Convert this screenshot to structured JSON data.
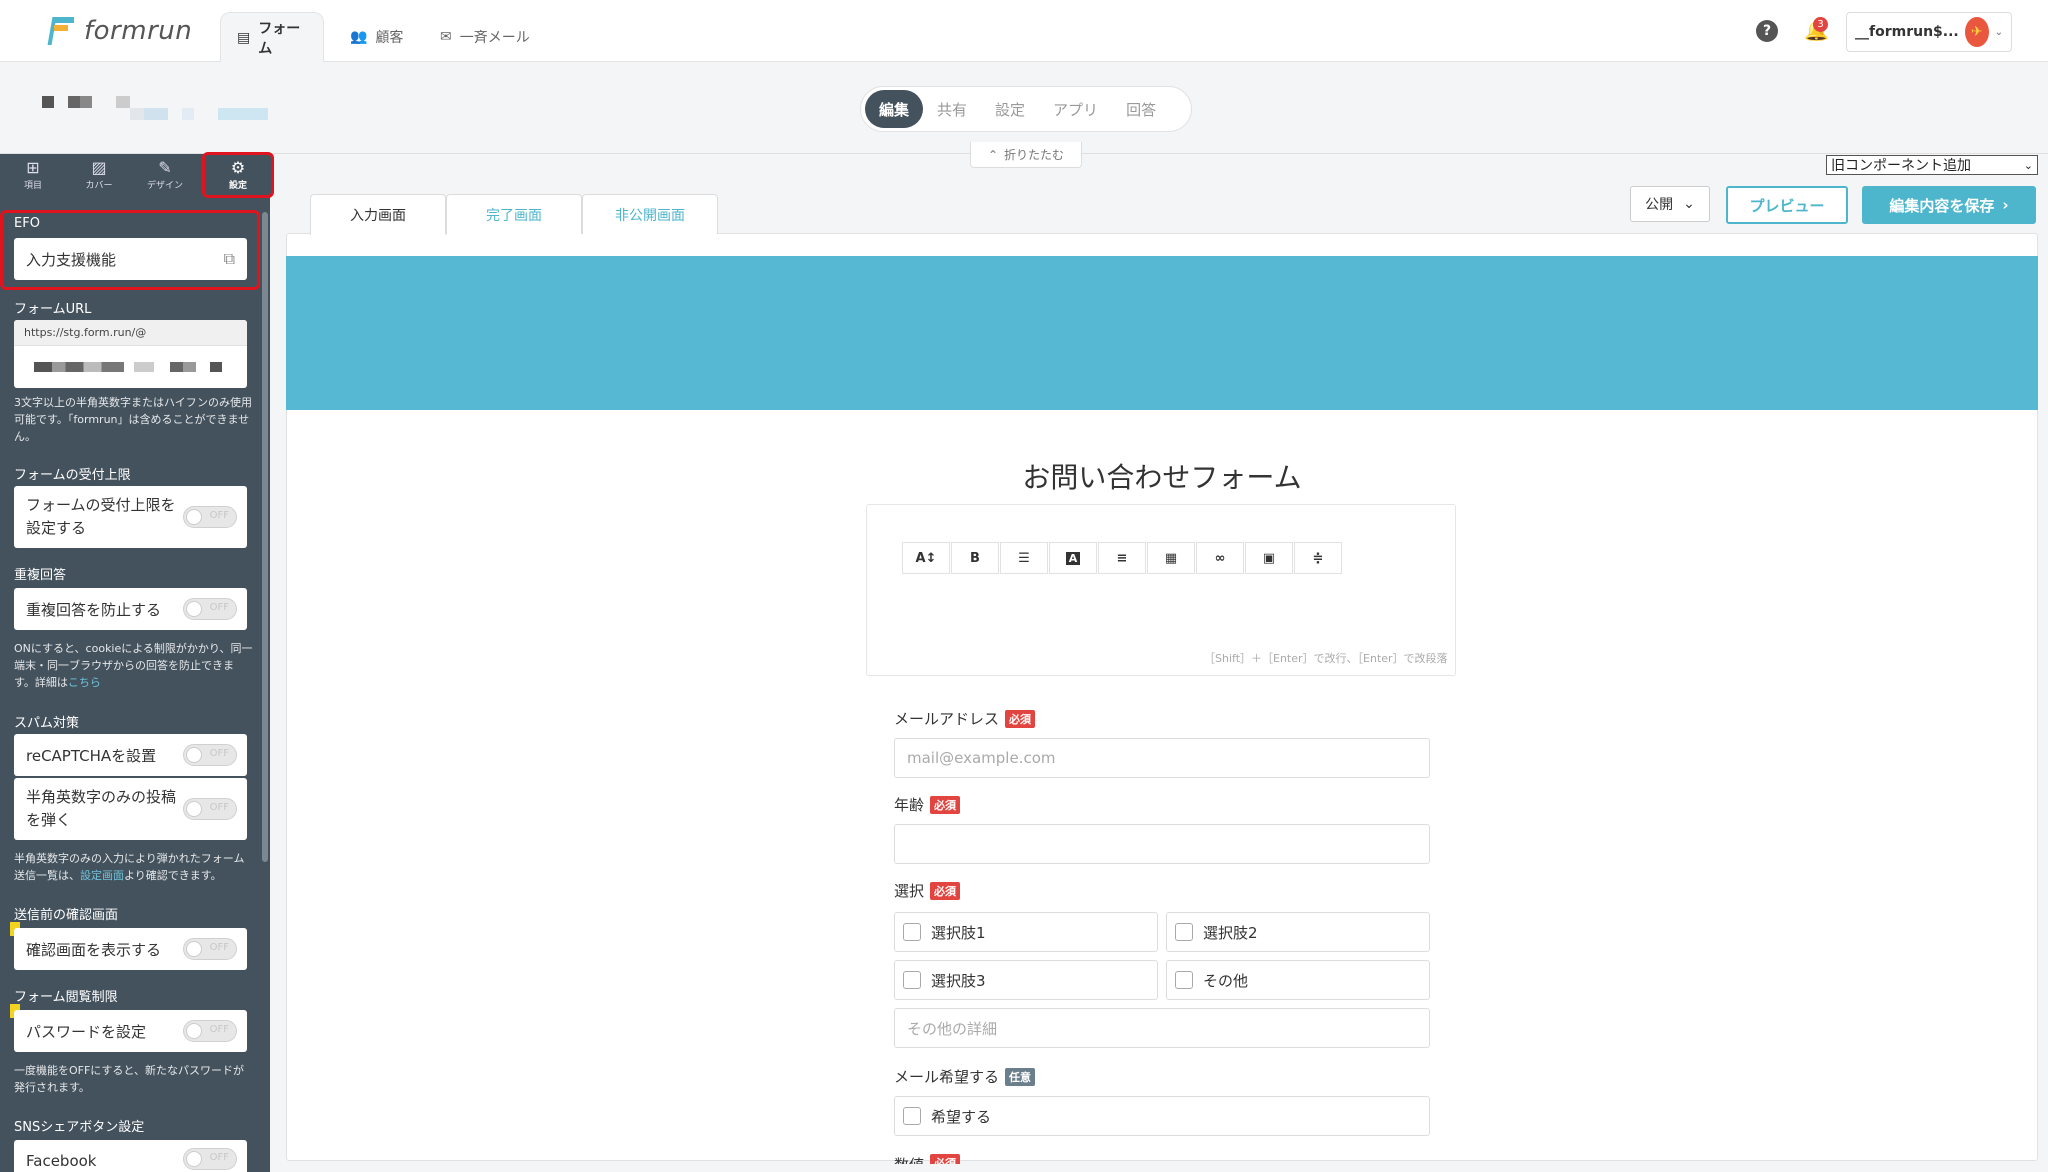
{
  "brand": {
    "name": "formrun",
    "accent": "#4db6cc",
    "sidebar_bg": "#44525d",
    "required_red": "#e2443f"
  },
  "topnav": {
    "tabs": [
      {
        "label": "フォーム",
        "icon": "document-icon"
      },
      {
        "label": "顧客",
        "icon": "users-icon"
      },
      {
        "label": "一斉メール",
        "icon": "mail-icon"
      }
    ],
    "help": "?",
    "notifications_count": "3",
    "account_name": "__formrun$..."
  },
  "mode_tabs": [
    "編集",
    "共有",
    "設定",
    "アプリ",
    "回答"
  ],
  "collapse_label": "折りたたむ",
  "sidebar": {
    "tabs": [
      {
        "label": "項目",
        "icon": "plus-square-icon"
      },
      {
        "label": "カバー",
        "icon": "image-icon"
      },
      {
        "label": "デザイン",
        "icon": "brush-icon"
      },
      {
        "label": "設定",
        "icon": "gear-icon"
      }
    ],
    "efo_title": "EFO",
    "efo_item": "入力支援機能",
    "url_title": "フォームURL",
    "url_prefix": "https://stg.form.run/@",
    "url_help": "3文字以上の半角英数字またはハイフンのみ使用可能です。「formrun」は含めることができません。",
    "limit_title": "フォームの受付上限",
    "limit_item": "フォームの受付上限を設定する",
    "dup_title": "重複回答",
    "dup_item": "重複回答を防止する",
    "dup_help": "ONにすると、cookieによる制限がかかり、同一端末・同一ブラウザからの回答を防止できます。詳細は",
    "dup_help_link": "こちら",
    "spam_title": "スパム対策",
    "spam_recaptcha": "reCAPTCHAを設置",
    "spam_alnum": "半角英数字のみの投稿を弾く",
    "spam_help_a": "半角英数字のみの入力により弾かれたフォーム送信一覧は、",
    "spam_help_link": "設定画面",
    "spam_help_b": "より確認できます。",
    "confirm_title": "送信前の確認画面",
    "confirm_item": "確認画面を表示する",
    "access_title": "フォーム閲覧制限",
    "access_item": "パスワードを設定",
    "access_help": "一度機能をOFFにすると、新たなパスワードが発行されます。",
    "sns_title": "SNSシェアボタン設定",
    "sns_facebook": "Facebook",
    "toggle_off": "OFF"
  },
  "main": {
    "old_component_select": "旧コンポーネント追加",
    "page_tabs": [
      "入力画面",
      "完了画面",
      "非公開画面"
    ],
    "publish_select": "公開",
    "preview_label": "プレビュー",
    "save_label": "編集内容を保存",
    "form_title": "お問い合わせフォーム",
    "editor_hint": "［Shift］＋［Enter］で改行、［Enter］で改段落",
    "toolbar_buttons": [
      "A↕",
      "B",
      "☰",
      "A",
      "≡",
      "▦",
      "∞",
      "▣",
      "≑"
    ],
    "fields": {
      "email_label": "メールアドレス",
      "email_placeholder": "mail@example.com",
      "age_label": "年齢",
      "select_label": "選択",
      "options": [
        "選択肢1",
        "選択肢2",
        "選択肢3",
        "その他"
      ],
      "other_placeholder": "その他の詳細",
      "mail_wish_label": "メール希望する",
      "mail_wish_option": "希望する",
      "next_label_partial": "数値"
    },
    "badge_required": "必須",
    "badge_optional": "任意"
  }
}
